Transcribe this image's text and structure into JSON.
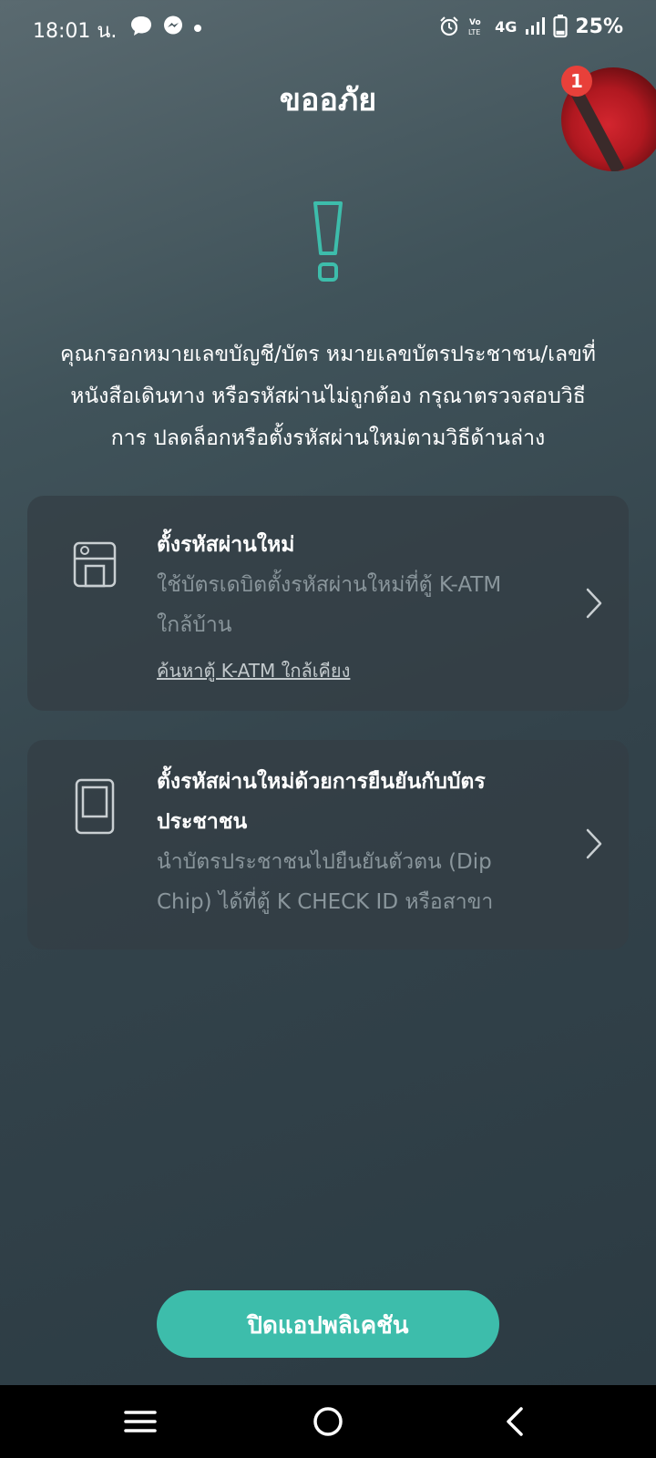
{
  "status_bar": {
    "time": "18:01 น.",
    "notification_icons": [
      "chat-bubble-icon",
      "messenger-icon",
      "dot-icon"
    ],
    "system_icons": [
      "alarm-icon",
      "volte-icon",
      "4g-icon",
      "signal-icon",
      "battery-icon"
    ],
    "network": "4G",
    "battery": "25%",
    "battery_level": 0.25
  },
  "header": {
    "title": "ขออภัย"
  },
  "chat_head": {
    "badge": "1"
  },
  "warning": {
    "icon": "exclamation-icon",
    "color": "#3dbdab"
  },
  "message": {
    "line1": "คุณกรอกหมายเลขบัญชี/บัตร หมายเลขบัตรประชาชน/เลขที่",
    "line2": "หนังสือเดินทาง หรือรหัสผ่านไม่ถูกต้อง กรุณาตรวจสอบวิธี",
    "line3": "การ ปลดล็อกหรือตั้งรหัสผ่านใหม่ตามวิธีด้านล่าง"
  },
  "options": [
    {
      "icon": "atm-icon",
      "title": "ตั้งรหัสผ่านใหม่",
      "desc_line1": "ใช้บัตรเดบิตตั้งรหัสผ่านใหม่ที่ตู้ K-ATM",
      "desc_line2": "ใกล้บ้าน",
      "link": "ค้นหาตู้ K-ATM ใกล้เคียง"
    },
    {
      "icon": "id-card-icon",
      "title_line1": "ตั้งรหัสผ่านใหม่ด้วยการยืนยันกับบัตร",
      "title_line2": "ประชาชน",
      "desc_line1": "นำบัตรประชาชนไปยืนยันตัวตน (Dip",
      "desc_line2": "Chip) ได้ที่ตู้ K CHECK ID หรือสาขา"
    }
  ],
  "footer": {
    "close_label": "ปิดแอปพลิเคชัน",
    "accent": "#3dbdab"
  },
  "nav_bar": {
    "icons": [
      "recents-icon",
      "home-icon",
      "back-icon"
    ]
  }
}
